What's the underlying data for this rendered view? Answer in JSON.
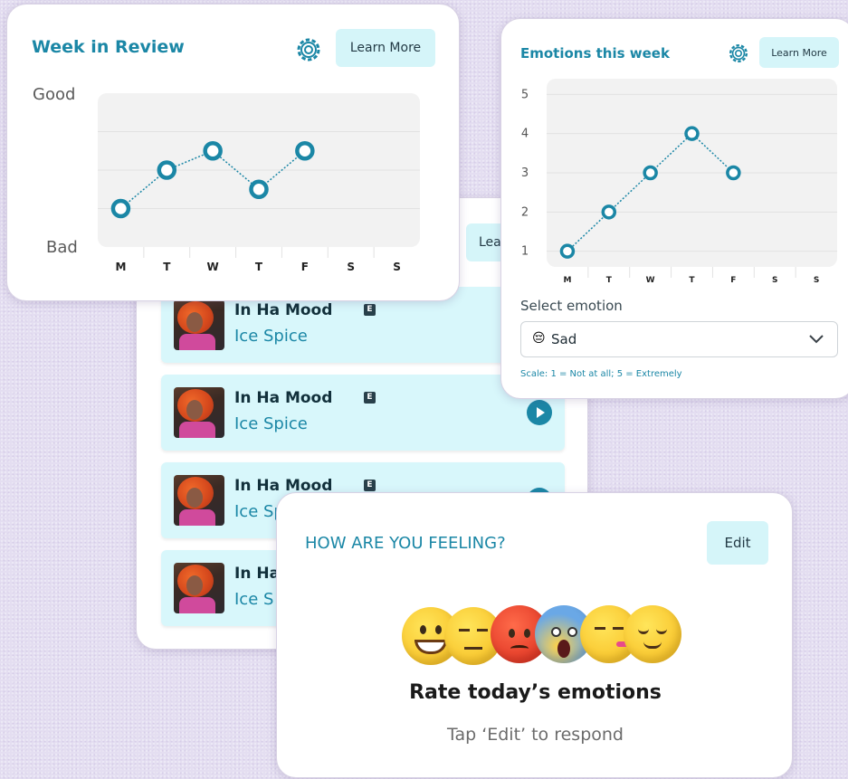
{
  "colors": {
    "accent": "#1b87a6",
    "button_bg": "#d5f5f9",
    "plot_bg": "#f2f2f2",
    "track_bg": "#d8f7fb",
    "background": "#e4def1"
  },
  "week_card": {
    "title": "Week in Review",
    "settings_icon": "gear-icon",
    "learn_more": "Learn More",
    "chart_data": {
      "type": "line",
      "title": "",
      "categories": [
        "M",
        "T",
        "W",
        "T",
        "F",
        "S",
        "S"
      ],
      "y_labels": [
        "Good",
        "Bad"
      ],
      "ylim": [
        0,
        4
      ],
      "series": [
        {
          "values": [
            1,
            2,
            2.5,
            1.5,
            2.5,
            null,
            null
          ]
        }
      ],
      "grid": true
    }
  },
  "emotions_card": {
    "title": "Emotions this week",
    "settings_icon": "gear-icon",
    "learn_more": "Learn More",
    "chart_data": {
      "type": "line",
      "title": "",
      "categories": [
        "M",
        "T",
        "W",
        "T",
        "F",
        "S",
        "S"
      ],
      "yticks": [
        "1",
        "2",
        "3",
        "4",
        "5"
      ],
      "ylim": [
        0.6,
        5.4
      ],
      "series": [
        {
          "values": [
            1,
            2,
            3,
            4,
            3,
            null,
            null
          ]
        }
      ],
      "grid": true
    },
    "select_label": "Select emotion",
    "selected_emoji": "😔",
    "selected_emotion": "Sad",
    "dropdown_icon": "chevron-down-icon",
    "scale_note": "Scale: 1 = Not  at all; 5 = Extremely"
  },
  "music_card": {
    "header_button": "Lea",
    "explicit_badge": "E",
    "tracks": [
      {
        "title": "In Ha Mood",
        "artist": "Ice Spice"
      },
      {
        "title": "In Ha Mood",
        "artist": "Ice Spice"
      },
      {
        "title": "In Ha Mood",
        "artist": "Ice Sp"
      },
      {
        "title": "In Ha",
        "artist": "Ice S"
      }
    ]
  },
  "feeling_card": {
    "title": "HOW ARE YOU FEELING?",
    "edit": "Edit",
    "heading": "Rate today’s emotions",
    "subtext": "Tap ‘Edit’ to respond",
    "emojis": [
      "grinning-face-emoji",
      "pensive-face-emoji",
      "angry-face-emoji",
      "screaming-face-emoji",
      "partying-face-emoji",
      "relieved-face-emoji"
    ]
  }
}
